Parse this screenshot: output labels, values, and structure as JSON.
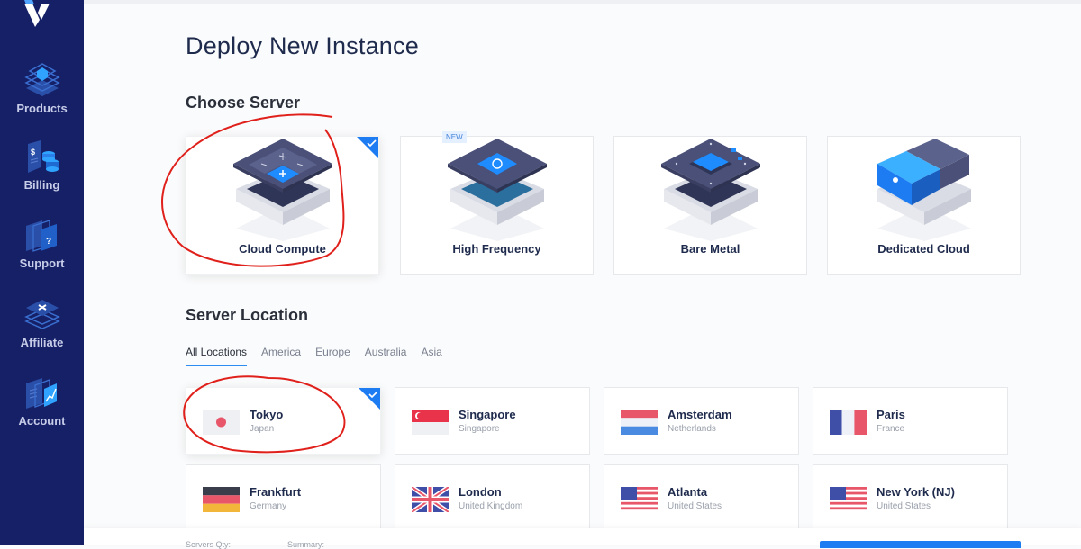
{
  "sidebar": {
    "logo": "vultr-logo",
    "items": [
      {
        "label": "Products",
        "icon": "products-icon"
      },
      {
        "label": "Billing",
        "icon": "billing-icon"
      },
      {
        "label": "Support",
        "icon": "support-icon"
      },
      {
        "label": "Affiliate",
        "icon": "affiliate-icon"
      },
      {
        "label": "Account",
        "icon": "account-icon"
      }
    ]
  },
  "page": {
    "title": "Deploy New Instance"
  },
  "choose_server": {
    "title": "Choose Server",
    "options": [
      {
        "label": "Cloud Compute",
        "selected": true,
        "badge": null
      },
      {
        "label": "High Frequency",
        "selected": false,
        "badge": "NEW"
      },
      {
        "label": "Bare Metal",
        "selected": false,
        "badge": null
      },
      {
        "label": "Dedicated Cloud",
        "selected": false,
        "badge": null
      }
    ]
  },
  "server_location": {
    "title": "Server Location",
    "tabs": [
      {
        "label": "All Locations",
        "active": true
      },
      {
        "label": "America",
        "active": false
      },
      {
        "label": "Europe",
        "active": false
      },
      {
        "label": "Australia",
        "active": false
      },
      {
        "label": "Asia",
        "active": false
      }
    ],
    "locations": [
      {
        "city": "Tokyo",
        "country": "Japan",
        "flag": "japan-flag",
        "selected": true
      },
      {
        "city": "Singapore",
        "country": "Singapore",
        "flag": "singapore-flag",
        "selected": false
      },
      {
        "city": "Amsterdam",
        "country": "Netherlands",
        "flag": "netherlands-flag",
        "selected": false
      },
      {
        "city": "Paris",
        "country": "France",
        "flag": "france-flag",
        "selected": false
      },
      {
        "city": "Frankfurt",
        "country": "Germany",
        "flag": "germany-flag",
        "selected": false
      },
      {
        "city": "London",
        "country": "United Kingdom",
        "flag": "uk-flag",
        "selected": false
      },
      {
        "city": "Atlanta",
        "country": "United States",
        "flag": "us-flag",
        "selected": false
      },
      {
        "city": "New York (NJ)",
        "country": "United States",
        "flag": "us-flag",
        "selected": false
      }
    ]
  },
  "footer": {
    "servers_qty_label": "Servers Qty:",
    "summary_label": "Summary:"
  },
  "colors": {
    "sidebar_bg": "#162067",
    "accent": "#1e7cf2",
    "annotation": "#e0201b"
  }
}
